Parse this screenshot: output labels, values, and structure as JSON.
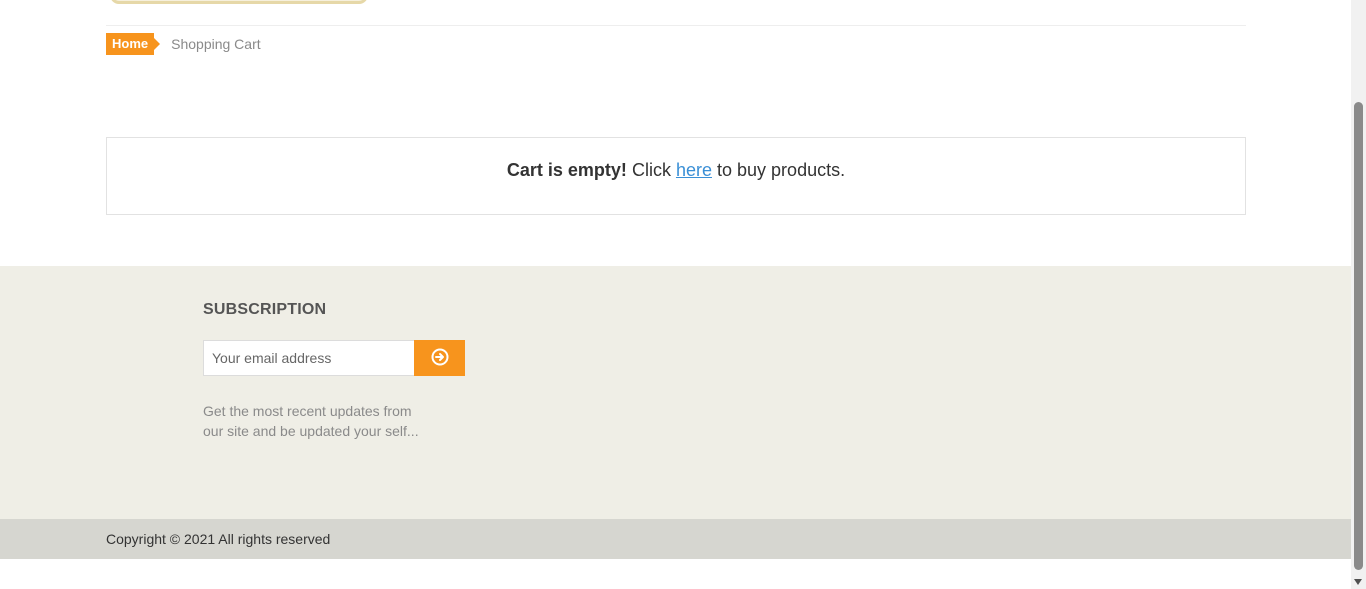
{
  "breadcrumb": {
    "home_label": "Home",
    "current_label": "Shopping Cart"
  },
  "cart": {
    "empty_strong": "Cart is empty!",
    "click_text": "Click",
    "link_text": "here",
    "suffix_text": "to buy products."
  },
  "subscription": {
    "title": "SUBSCRIPTION",
    "email_placeholder": "Your email address",
    "submit_icon": "arrow-circle-right-icon",
    "description": "Get the most recent updates from our site and be updated your self..."
  },
  "footer": {
    "copyright": "Copyright © 2021 All rights reserved"
  },
  "colors": {
    "accent": "#f7941d",
    "link": "#3a8fd6",
    "footer_bg": "#efeee6",
    "copyright_bg": "#d6d6d0"
  }
}
